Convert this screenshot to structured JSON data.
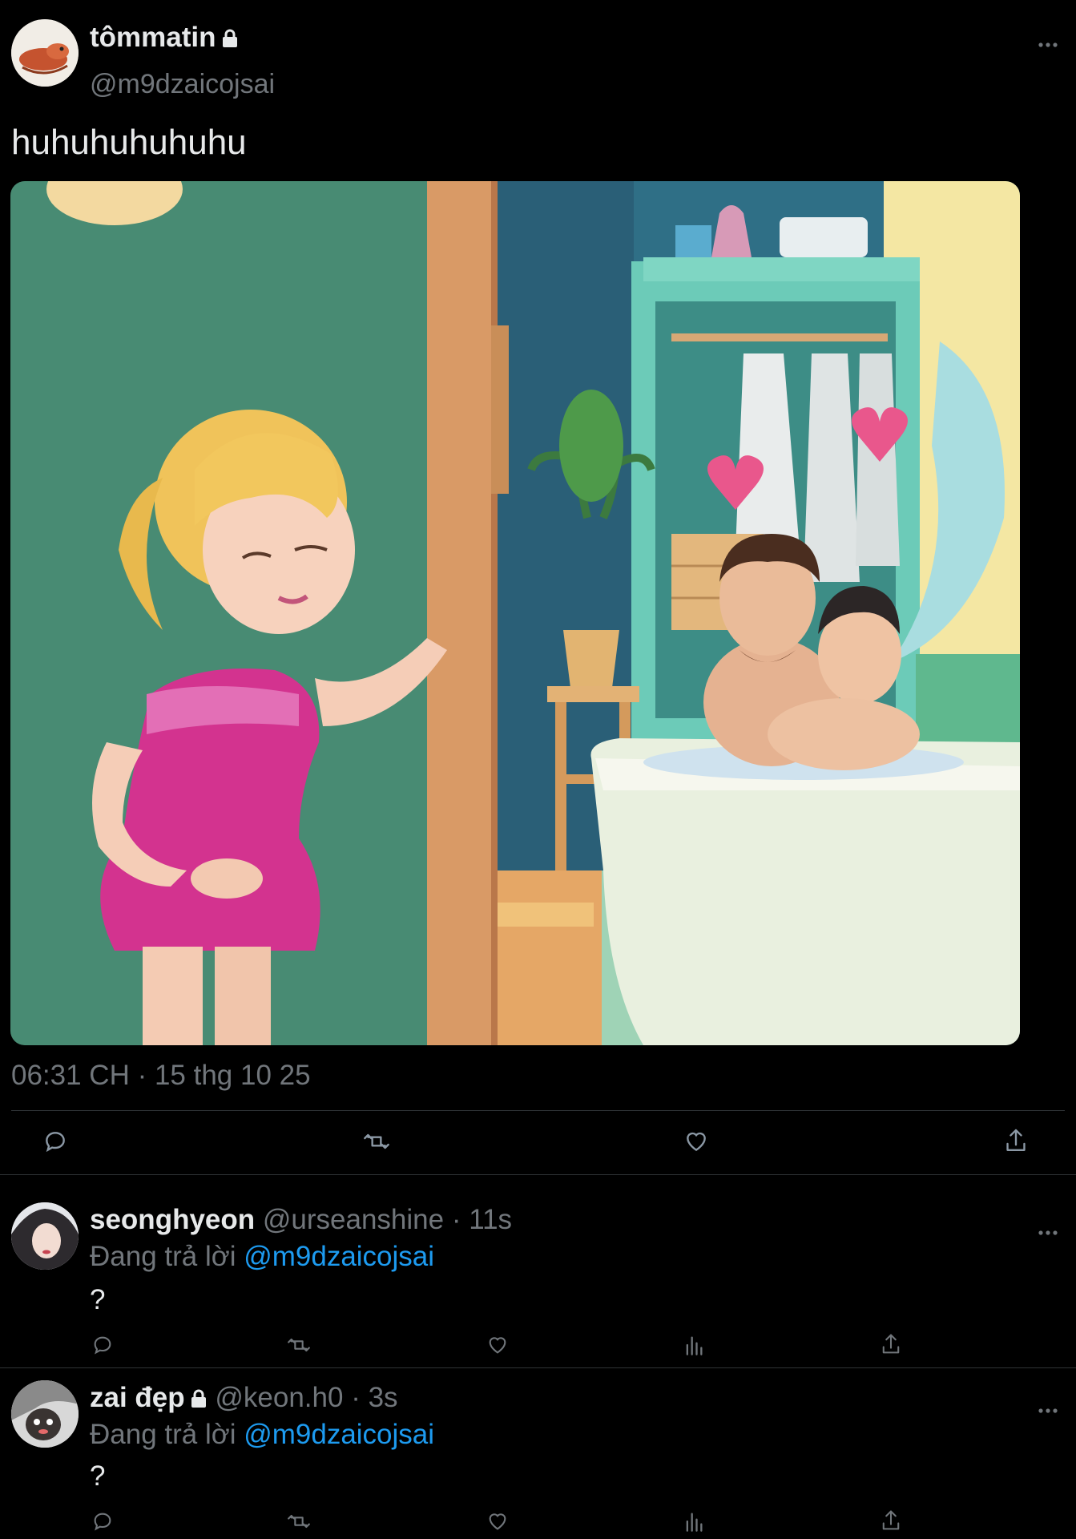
{
  "tweet": {
    "author_name": "tômmatin",
    "author_handle": "@m9dzaicojsai",
    "text": "huhuhuhuhuhu",
    "timestamp": "06:31 CH · 15 thg 10 25",
    "more_icon": "more-icon"
  },
  "replies": [
    {
      "name": "seonghyeon",
      "handle": "@urseanshine",
      "time": "· 11s",
      "replying_prefix": "Đang trả lời",
      "replying_to": "@m9dzaicojsai",
      "text": "?"
    },
    {
      "name": "zai đẹp",
      "handle": "@keon.h0",
      "time": "· 3s",
      "replying_prefix": "Đang trả lời",
      "replying_to": "@m9dzaicojsai",
      "text": "?"
    }
  ],
  "colors": {
    "background": "#000000",
    "text": "#e7e9ea",
    "muted": "#71767b",
    "link": "#1d9bf0",
    "divider": "#2f3336"
  }
}
